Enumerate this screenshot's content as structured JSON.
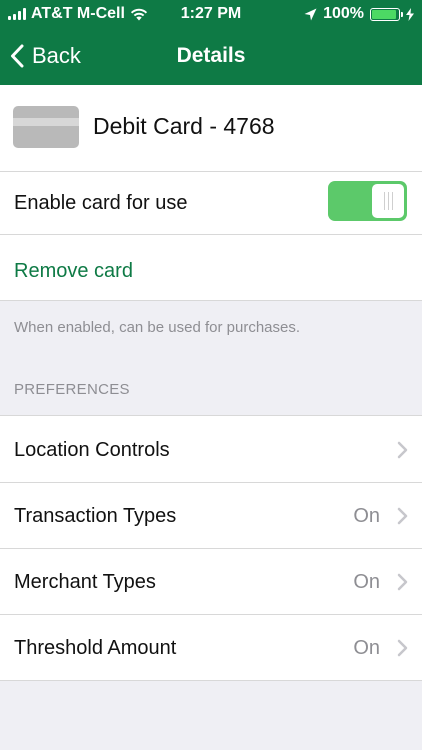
{
  "status_bar": {
    "carrier": "AT&T M-Cell",
    "time": "1:27 PM",
    "battery_percent": "100%",
    "battery_level": 1.0,
    "signal_bars": 4
  },
  "nav": {
    "back_label": "Back",
    "title": "Details"
  },
  "card": {
    "label": "Debit Card - 4768"
  },
  "enable_row": {
    "label": "Enable card for use",
    "enabled": true
  },
  "remove": {
    "label": "Remove card"
  },
  "help_text": "When enabled, can be used for purchases.",
  "preferences": {
    "header": "PREFERENCES",
    "items": [
      {
        "label": "Location Controls",
        "value": ""
      },
      {
        "label": "Transaction Types",
        "value": "On"
      },
      {
        "label": "Merchant Types",
        "value": "On"
      },
      {
        "label": "Threshold Amount",
        "value": "On"
      }
    ]
  },
  "colors": {
    "brand_green": "#0e7a45",
    "toggle_on": "#5cc96a",
    "battery_fill": "#4cd964",
    "secondary_text": "#8e8e93"
  }
}
